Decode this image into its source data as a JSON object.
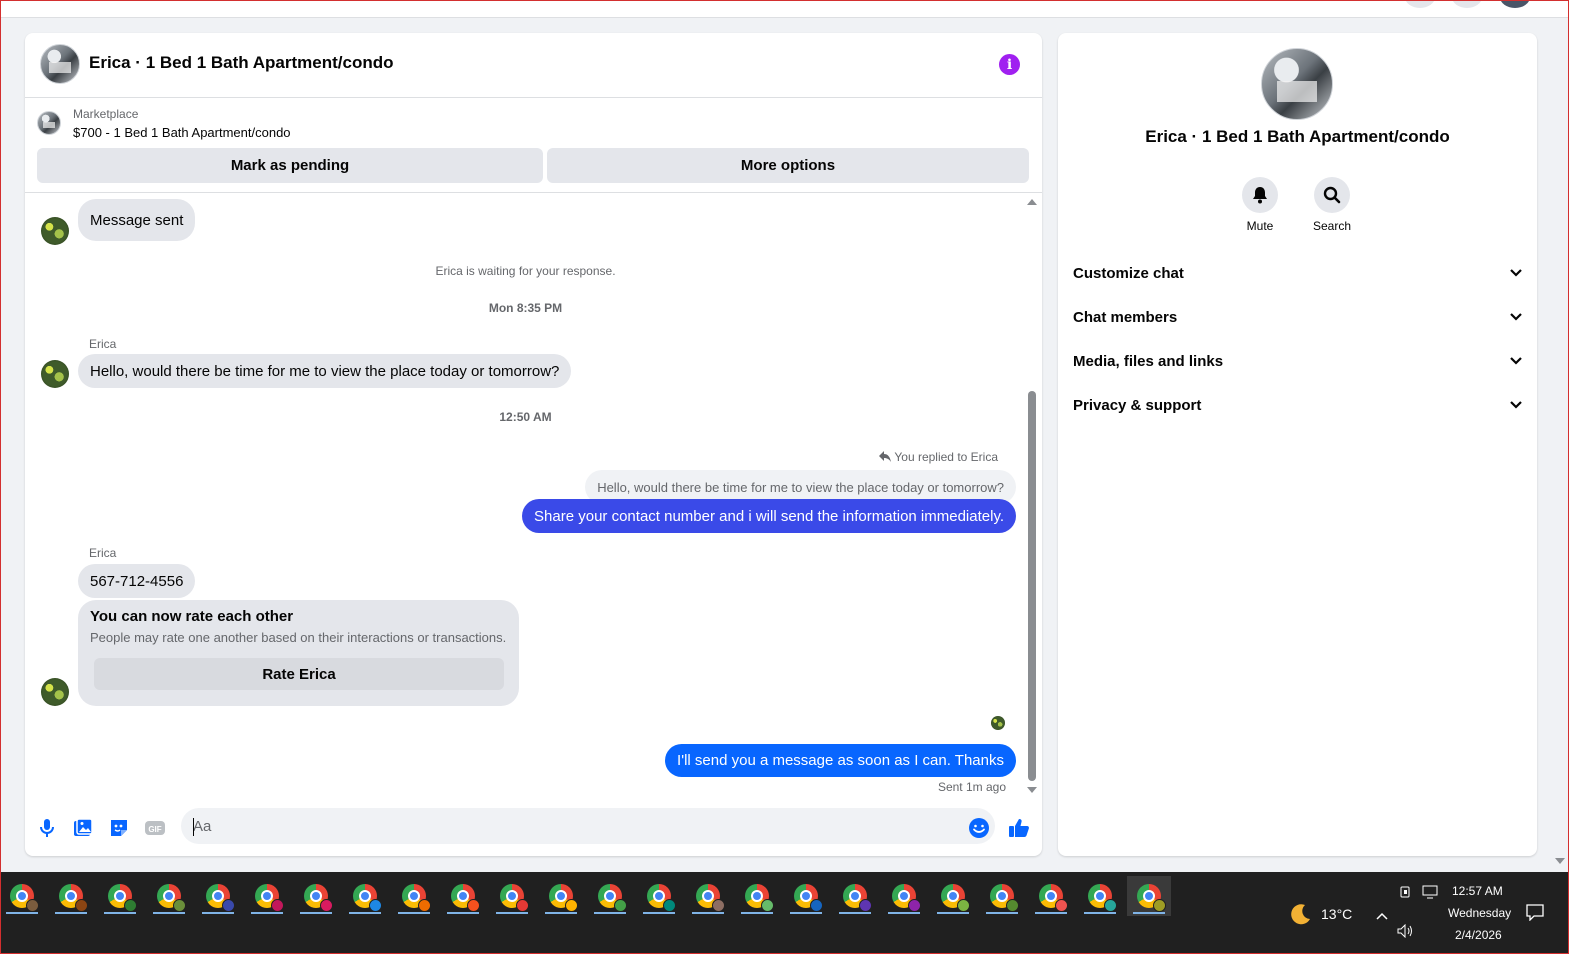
{
  "chat": {
    "title": "Erica · 1 Bed 1 Bath Apartment/condo",
    "marketplace_label": "Marketplace",
    "listing_text": "$700 - 1 Bed 1 Bath Apartment/condo",
    "mark_pending_label": "Mark as pending",
    "more_options_label": "More options"
  },
  "messages": {
    "message_sent": "Message sent",
    "waiting_notice": "Erica is waiting for your response.",
    "timestamp_1": "Mon 8:35 PM",
    "sender_name_1": "Erica",
    "incoming_1": "Hello, would there be time for me to view the place today or tomorrow?",
    "timestamp_2": "12:50 AM",
    "replied_to": "You replied to Erica",
    "quoted_text": "Hello, would there be time for me to view the place today or tomorrow?",
    "outgoing_1": "Share your contact number and i will send the information immediately.",
    "sender_name_2": "Erica",
    "incoming_2": "567-712-4556",
    "rate_title": "You can now rate each other",
    "rate_subtitle": "People may rate one another based on their interactions or transactions.",
    "rate_button": "Rate Erica",
    "outgoing_2": "I'll send you a message as soon as I can. Thanks",
    "sent_status": "Sent 1m ago"
  },
  "composer": {
    "placeholder": "Aa"
  },
  "side_panel": {
    "title": "Erica · 1 Bed 1 Bath Apartment/condo",
    "mute_label": "Mute",
    "search_label": "Search",
    "sections": [
      "Customize chat",
      "Chat members",
      "Media, files and links",
      "Privacy & support"
    ]
  },
  "taskbar": {
    "temperature": "13°C",
    "time": "12:57 AM",
    "day": "Wednesday",
    "date": "2/4/2026",
    "app_count": 24
  },
  "colors": {
    "outgoing_bubble_1": "#3a4ae8",
    "outgoing_bubble_2": "#0866ff",
    "info_icon": "#a020f0",
    "composer_icons": "#0866ff"
  },
  "icons": [
    "info-icon",
    "microphone-icon",
    "photo-icon",
    "sticker-icon",
    "gif-icon",
    "emoji-icon",
    "thumbs-up-icon",
    "bell-icon",
    "search-icon",
    "chevron-down-icon",
    "reply-icon",
    "moon-icon",
    "network-icon",
    "volume-icon",
    "notification-icon"
  ]
}
